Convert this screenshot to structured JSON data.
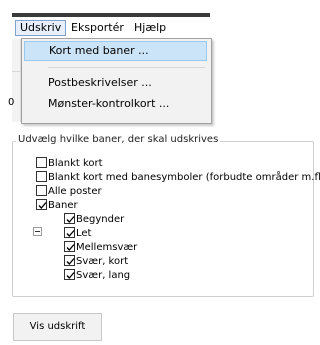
{
  "menubar": {
    "items": [
      "Udskriv",
      "Eksportér",
      "Hjælp"
    ]
  },
  "dropdown": {
    "items": [
      "Kort med baner ...",
      "Postbeskrivelser ...",
      "Mønster-kontrolkort ..."
    ]
  },
  "sliver_glyph": "0",
  "group": {
    "title": "Udvælg hvilke baner, der skal udskrives",
    "tree": [
      {
        "label": "Blankt kort",
        "checked": false
      },
      {
        "label": "Blankt kort med banesymboler (forbudte områder m.fl.)",
        "checked": false
      },
      {
        "label": "Alle poster",
        "checked": false
      },
      {
        "label": "Baner",
        "checked": true,
        "expanded": true
      },
      {
        "label": "Begynder",
        "checked": true
      },
      {
        "label": "Let",
        "checked": true
      },
      {
        "label": "Mellemsvær",
        "checked": true
      },
      {
        "label": "Svær, kort",
        "checked": true
      },
      {
        "label": "Svær, lang",
        "checked": true
      }
    ]
  },
  "print_button": {
    "label": "Vis udskrift"
  }
}
